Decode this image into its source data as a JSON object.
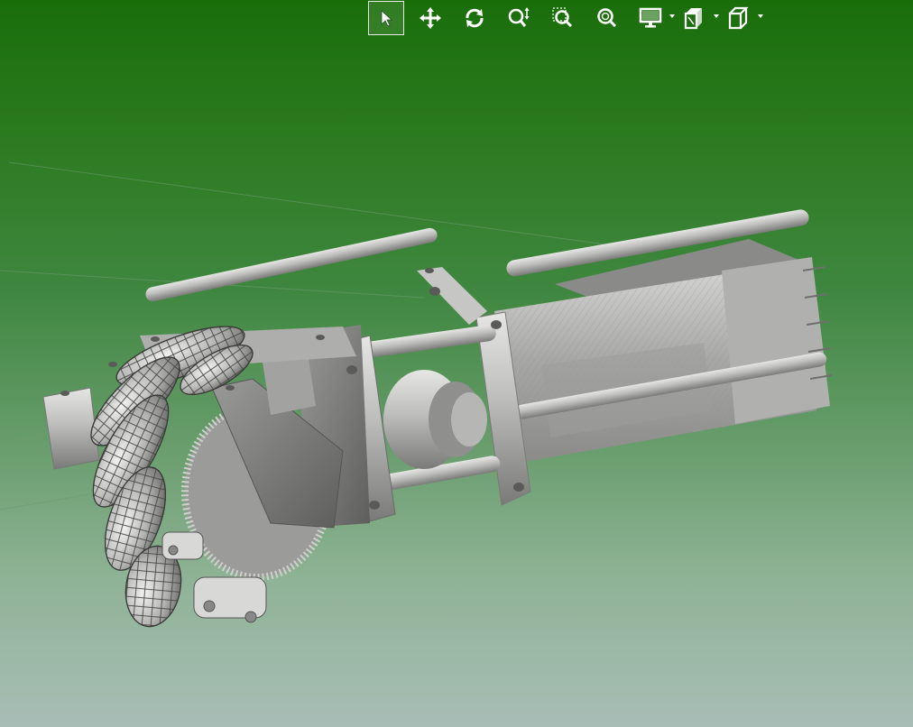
{
  "window": {
    "title": ""
  },
  "colors": {
    "background_top": "#1a6e0a",
    "background_bottom": "#a8bdb6",
    "toolbar_icon": "#ffffff",
    "model_metal": "#b8b8b6",
    "model_shadow": "#6e6e6c"
  },
  "toolbar": {
    "buttons": [
      {
        "id": "select",
        "icon": "arrow-pointer-icon",
        "selected": true,
        "has_dropdown": false
      },
      {
        "id": "pan",
        "icon": "move-arrows-icon",
        "selected": false,
        "has_dropdown": false
      },
      {
        "id": "rotate",
        "icon": "rotate-icon",
        "selected": false,
        "has_dropdown": false
      },
      {
        "id": "zoom",
        "icon": "zoom-updown-icon",
        "selected": false,
        "has_dropdown": false
      },
      {
        "id": "zoom-window",
        "icon": "zoom-window-icon",
        "selected": false,
        "has_dropdown": false
      },
      {
        "id": "zoom-fit",
        "icon": "zoom-fit-icon",
        "selected": false,
        "has_dropdown": false
      },
      {
        "id": "display",
        "icon": "monitor-icon",
        "selected": false,
        "has_dropdown": true
      },
      {
        "id": "section",
        "icon": "section-cube-icon",
        "selected": false,
        "has_dropdown": true
      },
      {
        "id": "view-orientation",
        "icon": "cube-icon",
        "selected": false,
        "has_dropdown": true
      }
    ]
  },
  "model": {
    "name": "",
    "description_visible": false
  }
}
